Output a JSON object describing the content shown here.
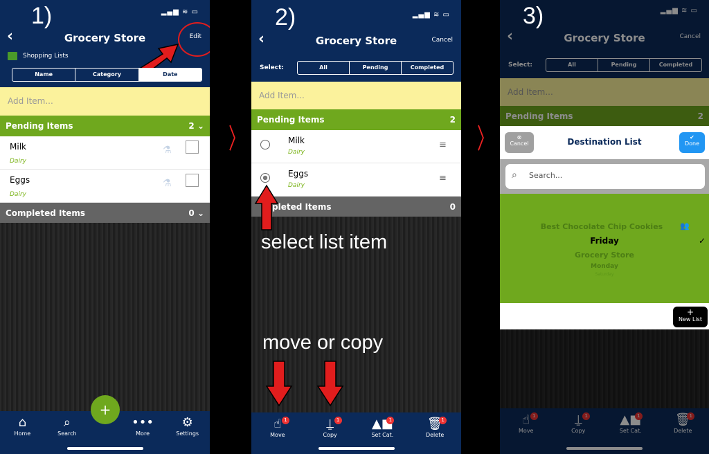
{
  "panel1": {
    "step": "1)",
    "title": "Grocery Store",
    "edit": "Edit",
    "folder": "Shopping Lists",
    "sort": [
      "Name",
      "Category",
      "Date"
    ],
    "add_placeholder": "Add Item...",
    "pending": {
      "label": "Pending Items",
      "count": "2"
    },
    "items": [
      {
        "name": "Milk",
        "category": "Dairy"
      },
      {
        "name": "Eggs",
        "category": "Dairy"
      }
    ],
    "completed": {
      "label": "Completed Items",
      "count": "0"
    },
    "nav": [
      "Home",
      "Search",
      "More",
      "Settings"
    ],
    "fab": "+"
  },
  "panel2": {
    "step": "2)",
    "title": "Grocery Store",
    "cancel": "Cancel",
    "select_label": "Select:",
    "select": [
      "All",
      "Pending",
      "Completed"
    ],
    "add_placeholder": "Add Item...",
    "pending": {
      "label": "Pending Items",
      "count": "2"
    },
    "items": [
      {
        "name": "Milk",
        "category": "Dairy",
        "selected": false
      },
      {
        "name": "Eggs",
        "category": "Dairy",
        "selected": true
      }
    ],
    "completed": {
      "label": "pleted Items",
      "count": "0"
    },
    "annotation1": "select list item",
    "annotation2": "move or copy",
    "toolbar": [
      {
        "label": "Move",
        "badge": "1"
      },
      {
        "label": "Copy",
        "badge": "1"
      },
      {
        "label": "Set Cat.",
        "badge": "1"
      },
      {
        "label": "Delete",
        "badge": "1"
      }
    ]
  },
  "panel3": {
    "step": "3)",
    "title": "Grocery Store",
    "cancel": "Cancel",
    "select_label": "Select:",
    "select": [
      "All",
      "Pending",
      "Completed"
    ],
    "add_placeholder": "Add Item...",
    "pending": {
      "label": "Pending Items",
      "count": "2"
    },
    "modal": {
      "cancel": "Cancel",
      "title": "Destination List",
      "done": "Done",
      "search_placeholder": "Search...",
      "lists": [
        "Best Chocolate Chip Cookies",
        "Friday",
        "Grocery Store",
        "Monday",
        "Saturday"
      ],
      "selected": "Friday",
      "new_list": "New List"
    },
    "toolbar": [
      {
        "label": "Move",
        "badge": "1"
      },
      {
        "label": "Copy",
        "badge": "1"
      },
      {
        "label": "Set Cat.",
        "badge": "1"
      },
      {
        "label": "Delete",
        "badge": "1"
      }
    ]
  },
  "colors": {
    "navy": "#0b2a5a",
    "green": "#6fa81e",
    "yellow": "#fbf29c",
    "annotation": "#e11d1d",
    "done": "#2196f3"
  }
}
